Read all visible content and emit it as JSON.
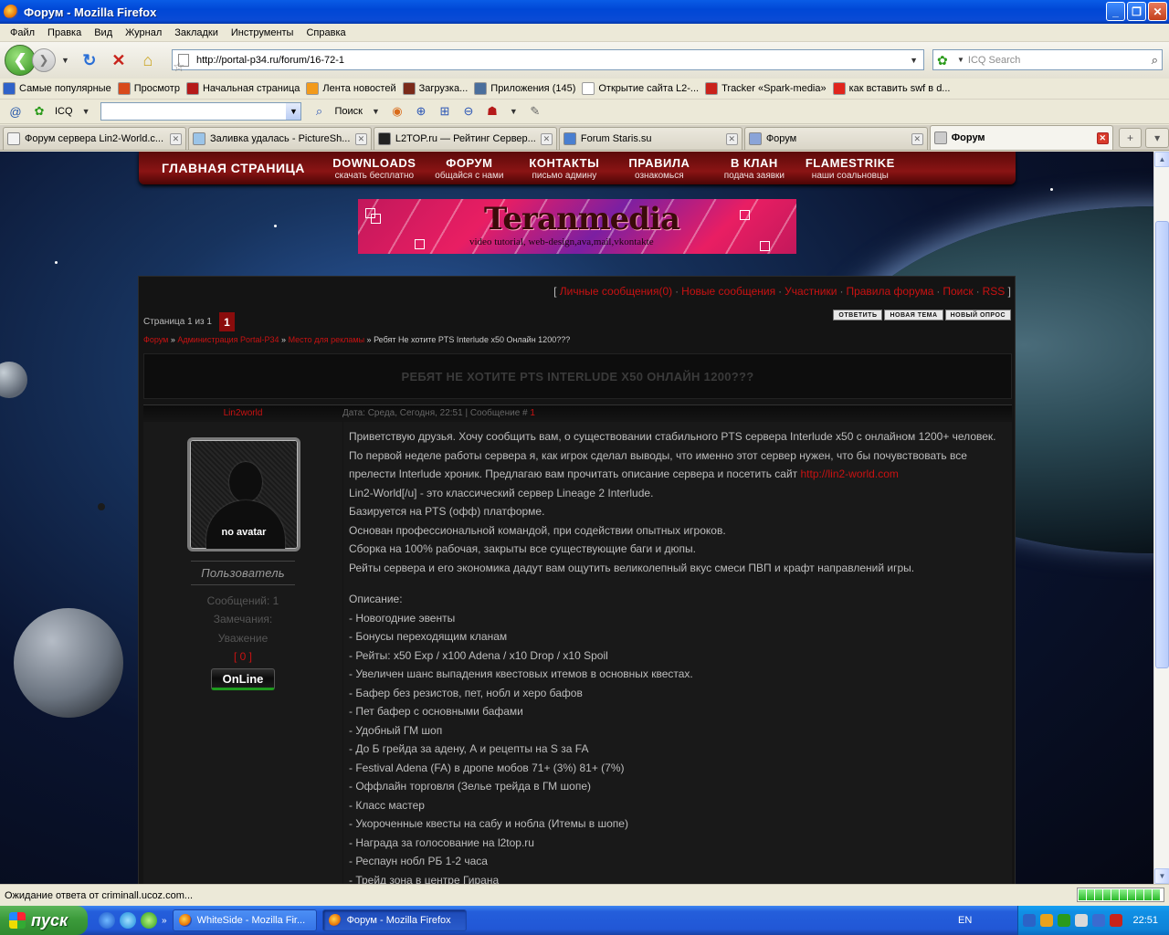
{
  "window": {
    "title": "Форум - Mozilla Firefox"
  },
  "menu": [
    "Файл",
    "Правка",
    "Вид",
    "Журнал",
    "Закладки",
    "Инструменты",
    "Справка"
  ],
  "nav": {
    "url": "http://portal-p34.ru/forum/16-72-1",
    "search_placeholder": "ICQ Search"
  },
  "bookmarks": [
    {
      "label": "Самые популярные",
      "icon": "popular-icon",
      "color": "#2f62c9"
    },
    {
      "label": "Просмотр",
      "icon": "joomla-icon",
      "color": "#d84a1b"
    },
    {
      "label": "Начальная страница",
      "icon": "dragon-icon",
      "color": "#b51a1a"
    },
    {
      "label": "Лента новостей",
      "icon": "rss-icon",
      "color": "#f29a1b"
    },
    {
      "label": "Загрузка...",
      "icon": "swirl-icon",
      "color": "#7a2a1a"
    },
    {
      "label": "Приложения (145)",
      "icon": "vk-icon",
      "color": "#4a6e9c"
    },
    {
      "label": "Открытие сайта L2-...",
      "icon": "page-icon",
      "color": "#ffffff"
    },
    {
      "label": "Tracker «Spark-media»",
      "icon": "spark-icon",
      "color": "#c9221b"
    },
    {
      "label": "как вставить swf в d...",
      "icon": "yandex-icon",
      "color": "#e0241c"
    }
  ],
  "icqbar": {
    "icq_label": "ICQ",
    "search_label": "Поиск"
  },
  "tabs": [
    {
      "label": "Форум сервера Lin2-World.c...",
      "icon": "doc-icon",
      "active": false
    },
    {
      "label": "Заливка удалась - PictureSh...",
      "icon": "pic-icon",
      "active": false
    },
    {
      "label": "L2TOP.ru — Рейтинг Сервер...",
      "icon": "l2top-icon",
      "active": false
    },
    {
      "label": "Forum Staris.su",
      "icon": "forum-icon",
      "active": false
    },
    {
      "label": "Форум",
      "icon": "feather-icon",
      "active": false
    },
    {
      "label": "Форум",
      "icon": "loading-icon",
      "active": true
    }
  ],
  "site": {
    "nav": [
      {
        "big": "ГЛАВНАЯ СТРАНИЦА",
        "small": ""
      },
      {
        "big": "DOWNLOADS",
        "small": "скачать бесплатно"
      },
      {
        "big": "ФОРУМ",
        "small": "общайся с нами"
      },
      {
        "big": "КОНТАКТЫ",
        "small": "письмо админу"
      },
      {
        "big": "ПРАВИЛА",
        "small": "ознакомься"
      },
      {
        "big": "В КЛАН",
        "small": "подача заявки"
      },
      {
        "big": "FLAMESTRIKE",
        "small": "наши соальновцы"
      }
    ],
    "banner": {
      "title": "Teranmedia",
      "tagline": "video tutorial, web-design,ava,mail,vkontakte"
    }
  },
  "forum": {
    "toplinks": [
      "Личные сообщения(0)",
      "Новые сообщения",
      "Участники",
      "Правила форума",
      "Поиск",
      "RSS"
    ],
    "paging_label": "Страница 1 из 1",
    "current_page": "1",
    "actions": [
      "ОТВЕТИТЬ",
      "НОВАЯ ТЕМА",
      "НОВЫЙ ОПРОС"
    ],
    "breadcrumbs": [
      "Форум",
      "Администрация Portal-P34",
      "Место для рекламы"
    ],
    "breadcrumb_current": "Ребят Не хотите PTS Interlude x50 Онлайн 1200???",
    "topic_title": "РЕБЯТ НЕ ХОТИТЕ PTS INTERLUDE X50 ОНЛАЙН 1200???",
    "post": {
      "author": "Lin2world",
      "date": "Дата: Среда, Сегодня, 22:51 | Сообщение #",
      "post_num": "1",
      "avatar_text": "no avatar",
      "rank": "Пользователь",
      "messages": "Сообщений: 1",
      "warnings": "Замечания:",
      "respect": "Уважение",
      "respect_value": "[ 0 ]",
      "online": "OnLine",
      "link_text": "http://lin2-world.com",
      "lines_a": [
        "Приветствую друзья. Хочу сообщить вам, о существовании стабильного PTS сервера Interlude x50 с онлайном 1200+ человек.",
        "По первой неделе работы сервера я, как игрок сделал выводы, что именно этот сервер нужен, что бы почувствовать все",
        "прелести Interlude хроник. Предлагаю вам прочитать описание сервера и посетить сайт "
      ],
      "lines_b": [
        "Lin2-World[/u] - это классический сервер Lineage 2 Interlude.",
        "Базируется на PTS (офф) платформе.",
        "Основан профессиональной командой, при содействии опытных игроков.",
        "Сборка на 100% рабочая, закрыты все существующие баги и дюпы.",
        "Рейты сервера и его экономика дадут вам ощутить великолепный вкус смеси ПВП и крафт направлений игры."
      ],
      "lines_c": [
        "Описание:",
        "- Новогодние эвенты",
        "- Бонусы переходящим кланам",
        "- Рейты: x50 Exp / x100 Adena / x10 Drop / x10 Spoil",
        "- Увеличен шанс выпадения квестовых итемов в основных квестах.",
        "- Бафер без резистов, пет, нобл и херо бафов",
        "- Пет бафер с основными бафами",
        "- Удобный ГМ шоп",
        "- До Б грейда за адену, А и рецепты на S за FA",
        "- Festival Adena (FA) в дропе мобов 71+ (3%) 81+ (7%)",
        "- Оффлайн торговля (Зелье трейда в ГМ шопе)",
        "- Класс мастер",
        "- Укороченные квесты на сабу и нобла (Итемы в шопе)",
        "- Награда за голосование на l2top.ru",
        "- Респаун нобл РБ 1-2 часа",
        "- Трейд зона в центре Гирана"
      ]
    }
  },
  "statusbar": {
    "text": "Ожидание ответа от criminall.ucoz.com...",
    "progress_blocks": 10
  },
  "taskbar": {
    "start": "пуск",
    "items": [
      {
        "label": "WhiteSide - Mozilla Fir...",
        "active": false
      },
      {
        "label": "Форум - Mozilla Firefox",
        "active": true
      }
    ],
    "lang": "EN",
    "clock": "22:51"
  }
}
